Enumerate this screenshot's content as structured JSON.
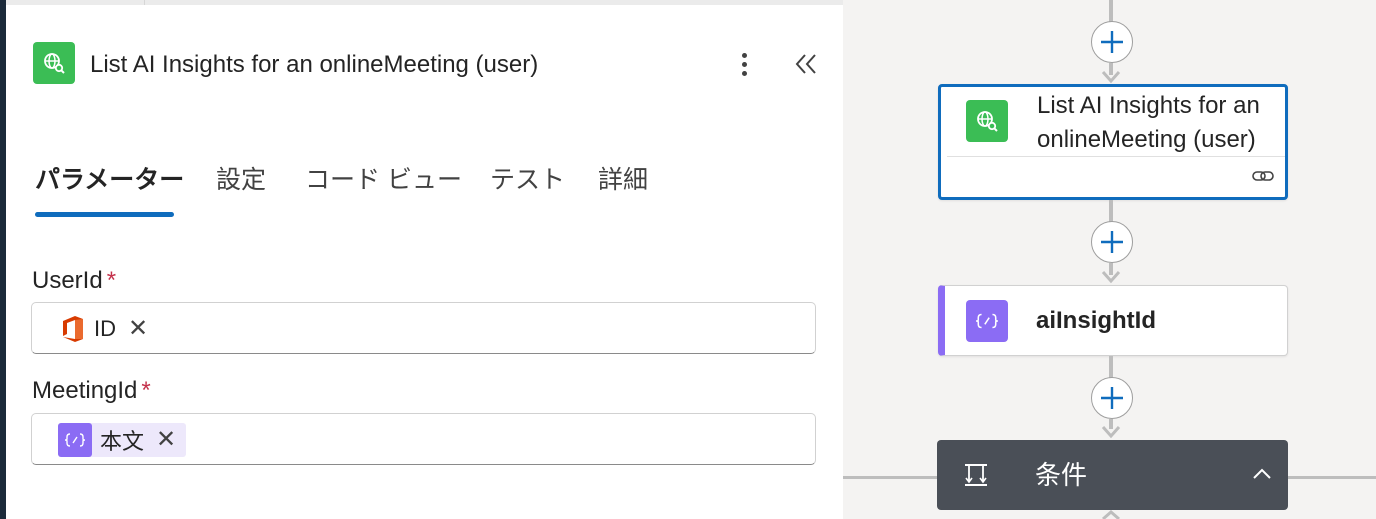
{
  "panel": {
    "title": "List AI Insights for an onlineMeeting (user)",
    "tabs": [
      {
        "label": "パラメーター",
        "active": true
      },
      {
        "label": "設定",
        "active": false
      },
      {
        "label": "コード ビュー",
        "active": false
      },
      {
        "label": "テスト",
        "active": false
      },
      {
        "label": "詳細",
        "active": false
      }
    ],
    "fields": [
      {
        "label": "UserId",
        "required_mark": "*",
        "token": {
          "text": "ID",
          "icon": "office-icon"
        }
      },
      {
        "label": "MeetingId",
        "required_mark": "*",
        "token": {
          "text": "本文",
          "icon": "expression-icon"
        }
      }
    ]
  },
  "canvas": {
    "cards": [
      {
        "title": "List AI Insights for an onlineMeeting (user)",
        "icon": "globe-search-icon",
        "selected": true,
        "link_icon": "link-icon"
      },
      {
        "title": "aiInsightId",
        "icon": "variable-icon"
      }
    ],
    "condition": {
      "title": "条件",
      "icon": "condition-icon",
      "chevron": "chevron-up-icon"
    }
  },
  "colors": {
    "accent": "#0f6cbd",
    "connector_green": "#3bbd55",
    "variable_purple": "#8b6cf4",
    "condition_bg": "#4a4f57"
  }
}
